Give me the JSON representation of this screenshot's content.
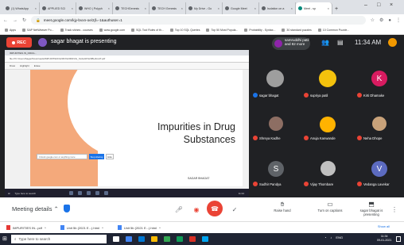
{
  "browser": {
    "tabs": [
      {
        "label": "(1) WhatsApp"
      },
      {
        "label": "APPLIED SCI"
      },
      {
        "label": "WHO | Polyph"
      },
      {
        "label": "TECHGenesis"
      },
      {
        "label": "TECH Genesis"
      },
      {
        "label": "My Drive - Go"
      },
      {
        "label": "Google Meet"
      },
      {
        "label": "Isolation on a"
      },
      {
        "label": "Meet - sp"
      }
    ],
    "url": "meet.google.com/kjy-bvxn-oe/2jf=-1&authuser=1",
    "bookmarks": [
      "Apps",
      "SAP NetWeaver Po...",
      "Track shines - courses",
      "www.google.com",
      "SQL Tool Rules of th...",
      "Top 10 SQL Queries",
      "Top 50 Most Popula...",
      "Probability - Syntax...",
      "30 standard puzzles",
      "10 Common Puzzle..."
    ]
  },
  "meet": {
    "rec_label": "REC",
    "presenting_label": "sagar bhagat is presenting",
    "joined_text": "samruddhi patil and 82 more",
    "clock": "11:34 AM",
    "participants": [
      {
        "name": "sagar bhagat",
        "avatar": "photo",
        "color": "#9e9e9e"
      },
      {
        "name": "supriya patil",
        "avatar": "photo",
        "color": "#f4c20d"
      },
      {
        "name": "Kirti Dhamake",
        "avatar": "letter",
        "letter": "K",
        "color": "#d81b60"
      },
      {
        "name": "Shreya Kadhe",
        "avatar": "photo",
        "color": "#8d6e63"
      },
      {
        "name": "Anuja Kanwande",
        "avatar": "photo",
        "color": "#ffb300"
      },
      {
        "name": "Neha Dhope",
        "avatar": "photo",
        "color": "#c8a27a"
      },
      {
        "name": "Sudhir Pandya",
        "avatar": "letter",
        "letter": "S",
        "color": "#5f6368"
      },
      {
        "name": "Vijay Thombare",
        "avatar": "photo",
        "color": "#c0c0c0"
      },
      {
        "name": "Vedanga Lavekar",
        "avatar": "letter",
        "letter": "V",
        "color": "#5c6bc0"
      }
    ]
  },
  "shared_screen": {
    "pdf_tab": "IMPURITIES.IN_DRUG...",
    "pdf_path": "file:///C:/Users/Sagar/Downloads/IMPURITIES%20IN%20DRUG_SAGAR%20BHAGAT.pdf",
    "pdf_controls": [
      "Draw",
      "Highlight",
      "Erase"
    ],
    "slide_title_line1": "Impurities in Drug",
    "slide_title_line2": "Substances",
    "slide_footer": "SAGAR BHAGAT",
    "slide_input_placeholder": "Unlock google.com or anything more",
    "slide_button": "Stop sharing",
    "slide_button2": "Hide",
    "inner_search": "Type here to search",
    "inner_clock": "11:34"
  },
  "bottom": {
    "meeting_details": "Meeting details",
    "raise_hand": "Raise hand",
    "captions": "Turn on captions",
    "presenting": "sagar bhagat is presenting"
  },
  "downloads": [
    {
      "label": "IMPURITIES IN...pdf"
    },
    {
      "label": "Unit 5b (2021 E...).html"
    },
    {
      "label": "Unit 5b (2021 E...).html"
    }
  ],
  "downloads_show_all": "Show all",
  "taskbar": {
    "search_placeholder": "Type here to search",
    "lang": "ENG",
    "time": "11:34",
    "date": "09-01-2021"
  }
}
